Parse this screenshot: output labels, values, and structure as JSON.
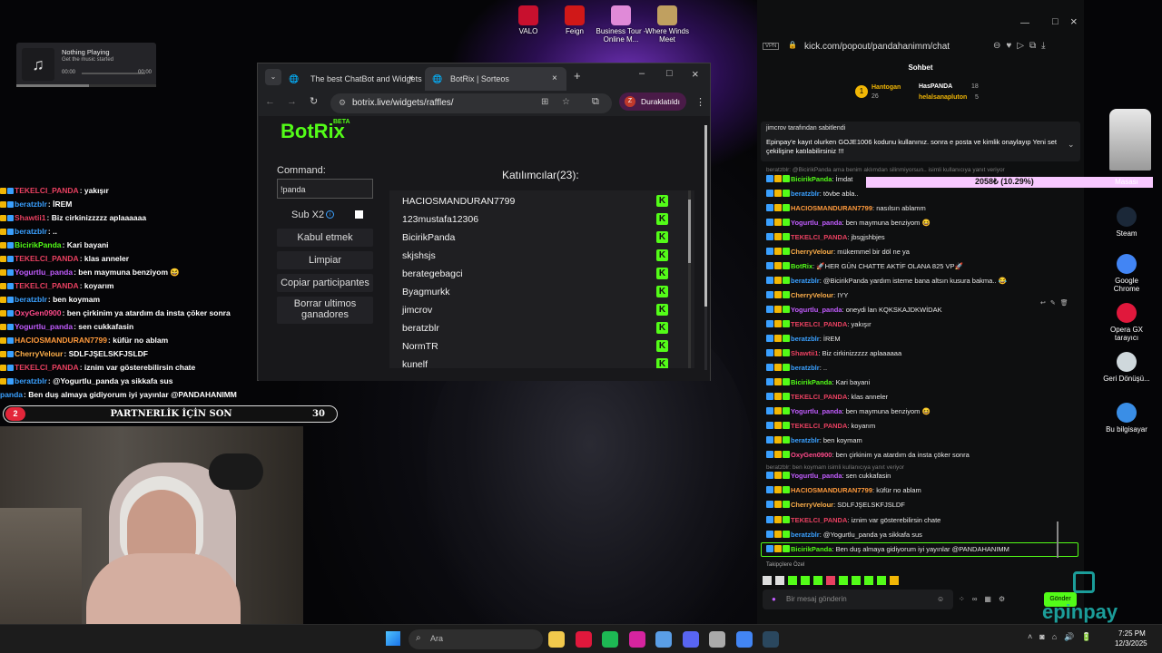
{
  "desktop": {
    "icons_top": [
      {
        "label": "VALO",
        "color": "#c8102e"
      },
      {
        "label": "Feign",
        "color": "#d01818"
      },
      {
        "label": "Business Tour - Online M...",
        "color": "#e08ad8"
      },
      {
        "label": "Where Winds Meet",
        "color": "#c0a060"
      }
    ],
    "icons_right": [
      {
        "label": "Masası",
        "color": "#aaaaaa"
      },
      {
        "label": "Steam",
        "color": "#1b2838"
      },
      {
        "label": "Google Chrome",
        "color": "#4285f4"
      },
      {
        "label": "Opera GX tarayıcı",
        "color": "#e0183c"
      },
      {
        "label": "Geri Dönüşü...",
        "color": "#cfd8dc"
      },
      {
        "label": "Bu bilgisayar",
        "color": "#3a8ee6"
      }
    ]
  },
  "music": {
    "title": "Nothing Playing",
    "subtitle": "Get the music started",
    "time_start": "00:00",
    "time_end": "00:00",
    "icon": "music-note-icon"
  },
  "overlay_chat": [
    {
      "user": "TEKELCI_PANDA",
      "text": "yakışır",
      "color": "#e84060"
    },
    {
      "user": "beratzblr",
      "text": "İREM",
      "color": "#3aa0ff"
    },
    {
      "user": "Shawtii1",
      "text": "Biz cirkinizzzzz aplaaaaaa",
      "color": "#e84060"
    },
    {
      "user": "beratzblr",
      "text": "..",
      "color": "#3aa0ff"
    },
    {
      "user": "BicirikPanda",
      "text": "Kari bayani",
      "color": "#53fc18"
    },
    {
      "user": "TEKELCI_PANDA",
      "text": "klas anneler",
      "color": "#e84060"
    },
    {
      "user": "Yogurtlu_panda",
      "text": "ben maymuna benziyom 😆",
      "color": "#c25cff"
    },
    {
      "user": "TEKELCI_PANDA",
      "text": "koyarım",
      "color": "#e84060"
    },
    {
      "user": "beratzblr",
      "text": "ben koymam",
      "color": "#3aa0ff"
    },
    {
      "user": "OxyGen0900",
      "text": "ben çirkinim ya atardım da insta çöker sonra",
      "color": "#ff4a8a"
    },
    {
      "user": "Yogurtlu_panda",
      "text": "sen cukkafasin",
      "color": "#c25cff"
    },
    {
      "user": "HACIOSMANDURAN7799",
      "text": "küfür no ablam",
      "color": "#ff9a3c"
    },
    {
      "user": "CherryVelour",
      "text": "SDLFJŞELSKFJSLDF",
      "color": "#ffb04a"
    },
    {
      "user": "TEKELCI_PANDA",
      "text": "iznim var gösterebilirsin chate",
      "color": "#e84060"
    },
    {
      "user": "beratzblr",
      "text": "@Yogurtlu_panda ya sikkafa sus",
      "color": "#3aa0ff"
    },
    {
      "user": "panda",
      "text": "Ben duş almaya gidiyorum iyi yayınlar @PANDAHANIMM",
      "color": "#3aa0ff"
    }
  ],
  "partner_bar": {
    "left_count": "2",
    "label": "PARTNERLİK İÇİN SON",
    "right_count": "30"
  },
  "browser": {
    "tabs": [
      {
        "label": "The best ChatBot and Widgets"
      },
      {
        "label": "BotRix | Sorteos"
      }
    ],
    "url": "botrix.live/widgets/raffles/",
    "profile_label": "Duraklatıldı",
    "profile_initial": "Z"
  },
  "botrix": {
    "logo": "BotRix",
    "beta": "BETA",
    "command_label": "Command:",
    "command_value": "!panda",
    "sub_label": "Sub X2",
    "buttons": [
      "Kabul etmek",
      "Limpiar",
      "Copiar participantes",
      "Borrar ultimos ganadores"
    ],
    "participants_title": "Katılımcılar(23):",
    "participants": [
      "HACIOSMANDURAN7799",
      "123mustafa12306",
      "BicirikPanda",
      "skjshsjs",
      "berategebagci",
      "Byagmurkk",
      "jimcrov",
      "beratzblr",
      "NormTR",
      "kunelf"
    ]
  },
  "kick": {
    "url": "kick.com/popout/pandahanimm/chat",
    "vpn": "VPN",
    "header": "Sohbet",
    "leaderboard": [
      {
        "name": "Hantogan",
        "value": "26"
      },
      {
        "name": "HasPANDA",
        "value": "18"
      },
      {
        "name": "helalsanapluton",
        "value": "5"
      }
    ],
    "pinned_by": "jimcrov tarafından sabitlendi",
    "pinned_text": "Epinpay'e kayıt olurken GOJE1006 kodunu kullanınız. sonra e posta ve kimlik onaylayıp Yeni set çekilişine katılabilirsiniz !!!",
    "deleted_note": "beratzblr: @BicirikPanda ama benim aklımdan silinmiyorsun.. isimli kullanıcıya yanıt veriyor",
    "donation_bar": "2058₺ (10.29%)",
    "messages": [
      {
        "user": "BicirikPanda",
        "text": "İmdat",
        "color": "#53fc18"
      },
      {
        "user": "beratzblr",
        "text": "tövbe abla..",
        "color": "#3aa0ff"
      },
      {
        "user": "HACIOSMANDURAN7799",
        "text": "nasılsın ablamm",
        "color": "#ff9a3c"
      },
      {
        "user": "Yogurtlu_panda",
        "text": "ben maymuna benziyom 😆",
        "color": "#c25cff"
      },
      {
        "user": "TEKELCI_PANDA",
        "text": "jbsgjshbjes",
        "color": "#e84060"
      },
      {
        "user": "CherryVelour",
        "text": "mükemmel bir döl ne ya",
        "color": "#ffb04a"
      },
      {
        "user": "BotRix",
        "text": "🚀HER GÜN CHATTE AKTİF OLANA 825 VP🚀",
        "color": "#53fc18"
      },
      {
        "user": "beratzblr",
        "text": "@BicirikPanda yardım isteme bana altsın kusura bakma.. 😂",
        "color": "#3aa0ff"
      },
      {
        "user": "CherryVelour",
        "text": "IYY",
        "color": "#ffb04a"
      },
      {
        "user": "Yogurtlu_panda",
        "text": "oneydi lan KQKSKAJDKWİDAK",
        "color": "#c25cff"
      },
      {
        "user": "TEKELCI_PANDA",
        "text": "yakışır",
        "color": "#e84060"
      },
      {
        "user": "beratzblr",
        "text": "İREM",
        "color": "#3aa0ff"
      },
      {
        "user": "Shawtii1",
        "text": "Biz cirkinizzzzz aplaaaaaa",
        "color": "#e84060"
      },
      {
        "user": "beratzblr",
        "text": "..",
        "color": "#3aa0ff"
      },
      {
        "user": "BicirikPanda",
        "text": "Kari bayani",
        "color": "#53fc18"
      },
      {
        "user": "TEKELCI_PANDA",
        "text": "klas anneler",
        "color": "#e84060"
      },
      {
        "user": "Yogurtlu_panda",
        "text": "ben maymuna benziyom 😆",
        "color": "#c25cff"
      },
      {
        "user": "TEKELCI_PANDA",
        "text": "koyarım",
        "color": "#e84060"
      },
      {
        "user": "beratzblr",
        "text": "ben koymam",
        "color": "#3aa0ff"
      },
      {
        "user": "OxyGen0900",
        "text": "ben çirkinim ya atardım da insta çöker sonra",
        "color": "#ff4a8a"
      }
    ],
    "reply_note": "beratzblr: ben koymam isimli kullanıcıya yanıt veriyor",
    "messages2": [
      {
        "user": "Yogurtlu_panda",
        "text": "sen cukkafasin",
        "color": "#c25cff"
      },
      {
        "user": "HACIOSMANDURAN7799",
        "text": "küfür no ablam",
        "color": "#ff9a3c"
      },
      {
        "user": "CherryVelour",
        "text": "SDLFJŞELSKFJSLDF",
        "color": "#ffb04a"
      },
      {
        "user": "TEKELCI_PANDA",
        "text": "iznim var gösterebilirsin chate",
        "color": "#e84060"
      },
      {
        "user": "beratzblr",
        "text": "@Yogurtlu_panda ya sikkafa sus",
        "color": "#3aa0ff"
      },
      {
        "user": "BicirikPanda",
        "text": "Ben duş almaya gidiyorum iyi yayınlar @PANDAHANIMM",
        "color": "#53fc18"
      }
    ],
    "emote_label": "Takipçilere Özel",
    "input_placeholder": "Bir mesaj gönderin",
    "send_label": "Gönder",
    "brand": "epinpay"
  },
  "taskbar": {
    "search_placeholder": "Ara",
    "time": "7:25 PM",
    "date": "12/3/2025",
    "app_icons": [
      {
        "name": "file-explorer-icon",
        "color": "#f2c94c"
      },
      {
        "name": "opera-icon",
        "color": "#e0183c"
      },
      {
        "name": "spotify-icon",
        "color": "#1db954"
      },
      {
        "name": "instagram-icon",
        "color": "#d6249f"
      },
      {
        "name": "app-icon",
        "color": "#5a9ee6"
      },
      {
        "name": "discord-icon",
        "color": "#5865f2"
      },
      {
        "name": "settings-icon",
        "color": "#aaaaaa"
      },
      {
        "name": "chrome-icon",
        "color": "#4285f4"
      },
      {
        "name": "steam-icon",
        "color": "#2a475e"
      }
    ]
  }
}
